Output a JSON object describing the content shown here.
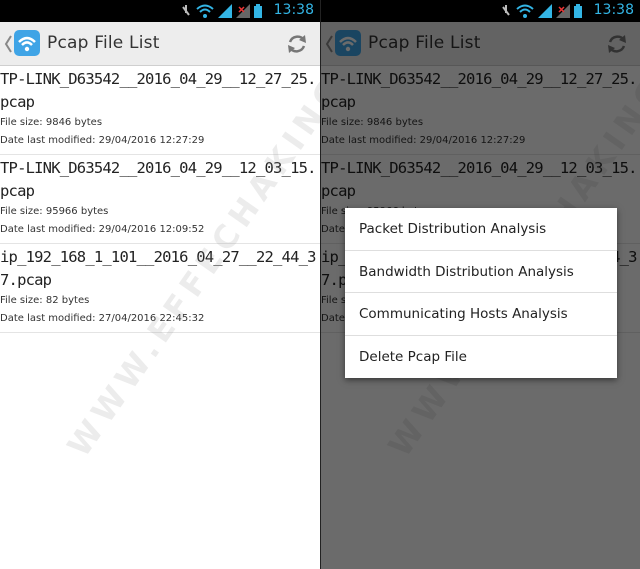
{
  "statusbar": {
    "time": "13:38",
    "icons": [
      "mute-icon",
      "wifi-icon",
      "signal-icon",
      "no-signal-icon",
      "battery-icon"
    ]
  },
  "actionbar": {
    "title": "Pcap File List",
    "app_icon": "wifi-app-icon",
    "refresh_icon": "refresh-icon"
  },
  "files": [
    {
      "name": "TP-LINK_D63542__2016_04_29__12_27_25.pcap",
      "size": "File size: 9846 bytes",
      "modified": "Date last modified: 29/04/2016 12:27:29"
    },
    {
      "name": "TP-LINK_D63542__2016_04_29__12_03_15.pcap",
      "size": "File size: 95966 bytes",
      "modified": "Date last modified: 29/04/2016 12:09:52"
    },
    {
      "name": "ip_192_168_1_101__2016_04_27__22_44_37.pcap",
      "size": "File size: 82 bytes",
      "modified": "Date last modified: 27/04/2016 22:45:32"
    }
  ],
  "context_menu": {
    "items": [
      "Packet Distribution Analysis",
      "Bandwidth Distribution Analysis",
      "Communicating Hosts Analysis",
      "Delete Pcap File"
    ]
  },
  "watermark": "WWW.EFFECHAKING.COM",
  "colors": {
    "accent": "#33b5e5",
    "app_icon_bg": "#3fa4e6",
    "actionbar_bg": "#ededed"
  }
}
